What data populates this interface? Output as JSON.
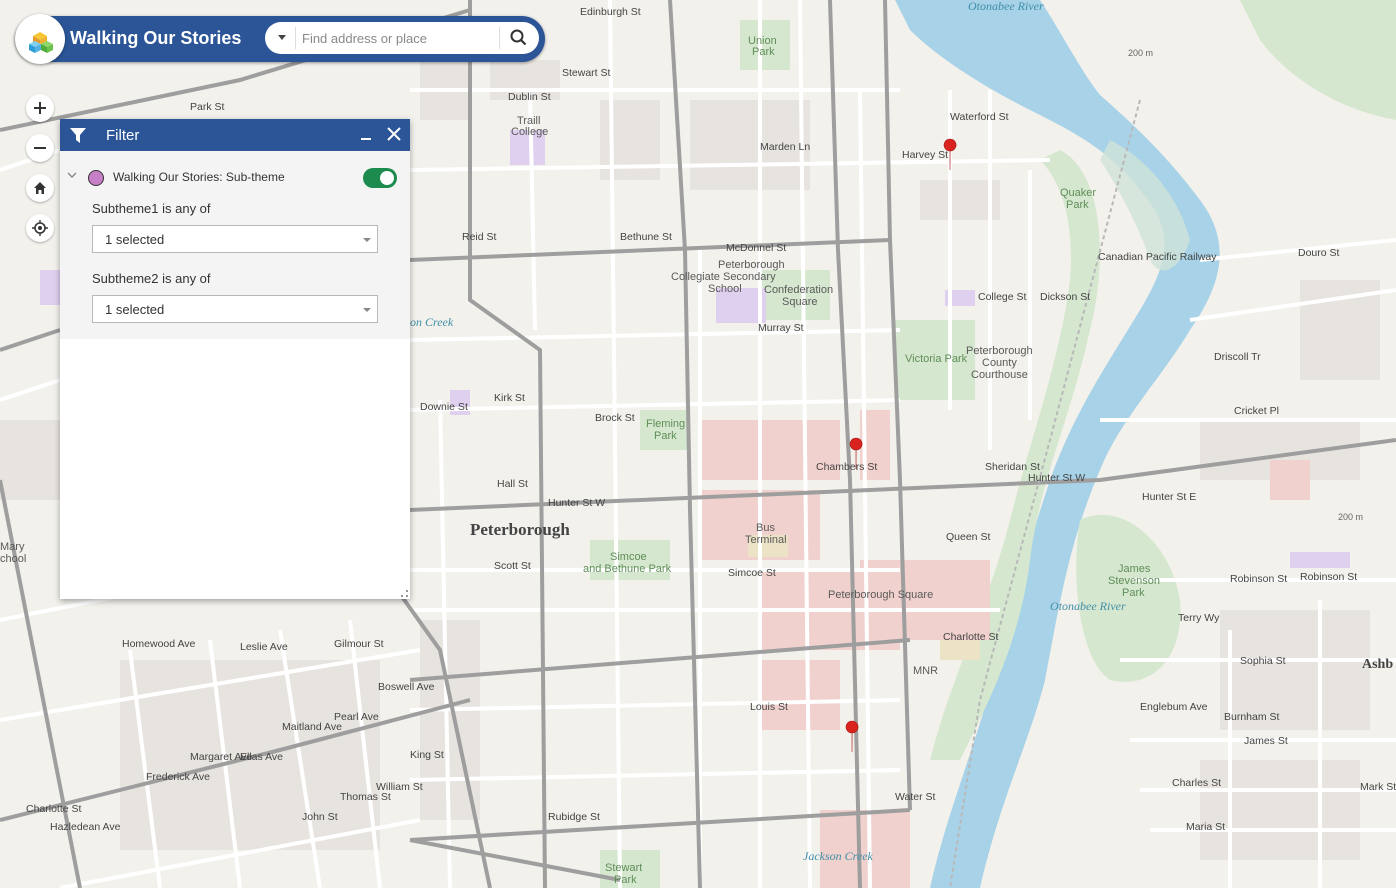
{
  "app": {
    "title": "Walking Our Stories"
  },
  "search": {
    "placeholder": "Find address or place"
  },
  "map_controls": [
    "zoom-in",
    "zoom-out",
    "home",
    "locate"
  ],
  "filter_panel": {
    "title": "Filter",
    "layer_name": "Walking Our Stories: Sub-theme",
    "layer_enabled": true,
    "layer_color": "#c77fc7",
    "conditions": [
      {
        "label": "Subtheme1 is any of",
        "value": "1 selected"
      },
      {
        "label": "Subtheme2 is any of",
        "value": "1 selected"
      }
    ]
  },
  "colors": {
    "header": "#2b5597",
    "toggle_on": "#1d8a4e",
    "marker": "#d9231f",
    "water": "#a8d2e8"
  },
  "map_labels": {
    "city": "Peterborough",
    "places": [
      "Traill College",
      "Union Park",
      "Peterborough Collegiate Secondary School",
      "Confederation Square",
      "Quaker Park",
      "Victoria Park",
      "Peterborough County Courthouse",
      "Fleming Park",
      "Bus Terminal",
      "Simcoe and Bethune Park",
      "Peterborough Square",
      "James Stevenson Park",
      "MNR",
      "Stewart Park",
      "Mary School",
      "Ashb"
    ],
    "streets": [
      "Edinburgh St",
      "Dublin St",
      "McDonnel St",
      "Murray St",
      "Brock St",
      "Hunter St W",
      "Hunter St E",
      "Simcoe St",
      "Charlotte St",
      "King St",
      "Sophia St",
      "James St",
      "Charles St",
      "Maria St",
      "Douro St",
      "Cricket Pl",
      "Driscoll Tr",
      "Robinson St",
      "Terry Wy",
      "Reid St",
      "Rubidge St",
      "Water St",
      "Bethune St",
      "Stewart St",
      "Park St",
      "Harvey St",
      "Waterford St",
      "College St",
      "Dickson St",
      "Sheridan St",
      "Chambers St",
      "Queen St",
      "Louis St",
      "Kirk St",
      "Hall St",
      "Scott St",
      "Downie St",
      "Homewood Ave",
      "Leslie Ave",
      "Gilmour St",
      "Boswell Ave",
      "Pearl Ave",
      "Maitland Ave",
      "Margaret Ave",
      "Ellas Ave",
      "Frederick Ave",
      "Thomas St",
      "John St",
      "William St",
      "Hazledean Ave",
      "Englebum Ave",
      "Burnham St",
      "Mark St",
      "Marden Ln",
      "Canadian Pacific Railway"
    ],
    "water": [
      "Otonabee River",
      "Jackson Creek"
    ]
  },
  "scale_labels": [
    "200 m"
  ]
}
